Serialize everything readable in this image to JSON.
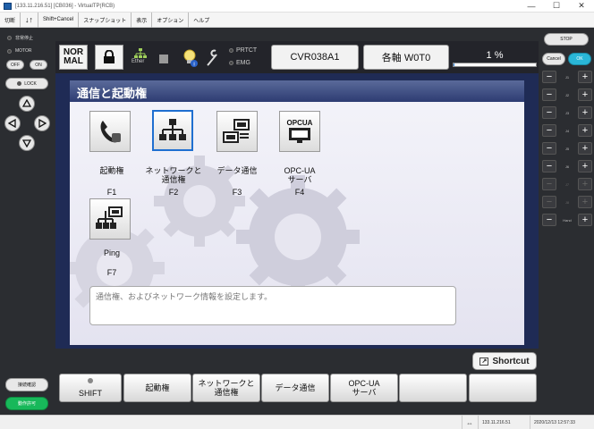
{
  "window": {
    "title": "[133.11.216.51] [CB036] - VirtualTP(RCB)",
    "min": "—",
    "max": "☐",
    "close": "✕"
  },
  "menu": {
    "items": [
      "切断",
      "Shift+Cancel",
      "スナップショット",
      "表示",
      "オプション",
      "ヘルプ"
    ],
    "updown_icon": "updown-arrows-icon"
  },
  "left_panel": {
    "estop": "非常停止",
    "motor": "MOTOR",
    "off": "OFF",
    "on": "ON",
    "lock": "LOCK",
    "confirm": "接続確認",
    "permit": "動作許可"
  },
  "toolbar": {
    "mode": "NOR\nMAL",
    "ether": "Ether",
    "prtct": "PRTCT",
    "emg": "EMG",
    "program": "CVR038A1",
    "axis": "各軸 W0T0",
    "speed_label": "1 %",
    "speed_fraction": 0.01
  },
  "main": {
    "title": "通信と起動権",
    "description": "通信権、およびネットワーク情報を設定します。",
    "icons": [
      {
        "label": "起動権",
        "key": "F1"
      },
      {
        "label": "ネットワークと\n通信権",
        "key": "F2"
      },
      {
        "label": "データ通信",
        "key": "F3"
      },
      {
        "label": "OPC-UA\nサーバ",
        "key": "F4",
        "badge": "OPCUA"
      },
      {
        "label": "Ping",
        "key": "F7"
      }
    ]
  },
  "shortcut": {
    "label": "Shortcut"
  },
  "fkeys": {
    "shift": "SHIFT",
    "f1": "起動権",
    "f2": "ネットワークと\n通信権",
    "f3": "データ通信",
    "f4": "OPC-UA\nサーバ"
  },
  "right_panel": {
    "stop": "STOP",
    "cancel": "Cancel",
    "ok": "OK",
    "jogs": [
      "J1",
      "J2",
      "J3",
      "J4",
      "J5",
      "J6",
      "J7",
      "J8",
      "Hand"
    ],
    "minus": "−",
    "plus": "+"
  },
  "status": {
    "ip": "133.11.216.51",
    "datetime": "2020/12/13 12:57:33",
    "arrow": "⇔"
  },
  "colors": {
    "accent_blue": "#1f6fd0",
    "ok_cyan": "#2ab7d8",
    "permit_green": "#18b85a",
    "panel_navy": "#1f2b55"
  }
}
